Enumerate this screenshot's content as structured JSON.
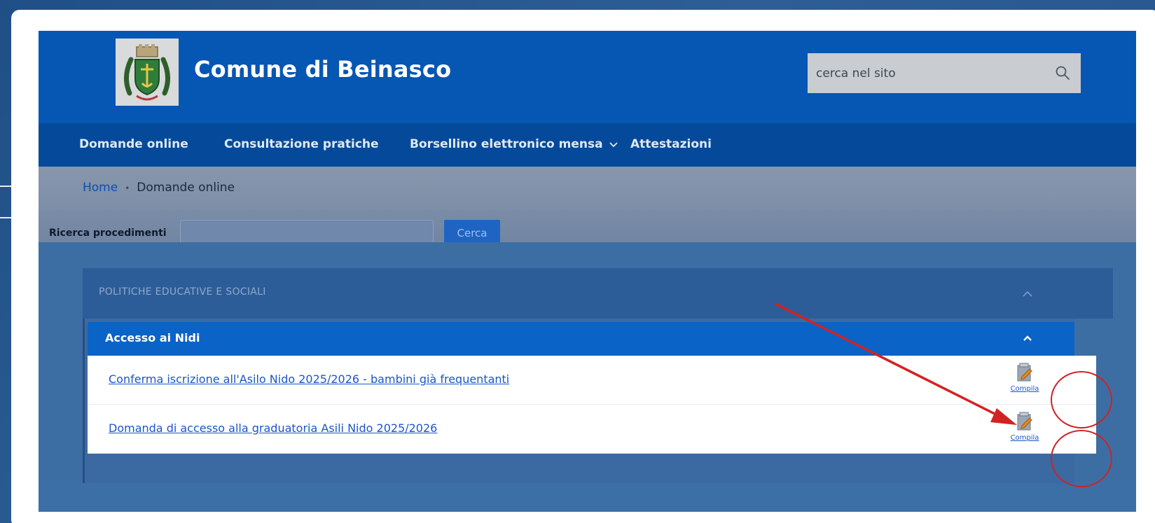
{
  "header": {
    "site_title": "Comune di Beinasco",
    "search_placeholder": "cerca nel sito"
  },
  "nav": {
    "items": [
      {
        "label": "Domande online"
      },
      {
        "label": "Consultazione pratiche"
      },
      {
        "label": "Borsellino elettronico mensa"
      },
      {
        "label": "Attestazioni"
      }
    ]
  },
  "breadcrumb": {
    "home": "Home",
    "current": "Domande online"
  },
  "search": {
    "label": "Ricerca procedimenti",
    "value": "",
    "button_label": "Cerca"
  },
  "panel": {
    "title": "POLITICHE EDUCATIVE E SOCIALI",
    "subsection": {
      "title": "Accesso ai Nidi",
      "rows": [
        {
          "link": "Conferma iscrizione all'Asilo Nido 2025/2026 - bambini già frequentanti",
          "action": "Compila"
        },
        {
          "link": "Domanda di accesso alla graduatoria Asili Nido 2025/2026",
          "action": "Compila"
        }
      ]
    }
  },
  "colors": {
    "header_bg": "#0656b4",
    "nav_bg": "#054a9a",
    "subsection_bg": "#0a63c7",
    "link": "#1a55c9",
    "annotation": "#cc2424"
  }
}
